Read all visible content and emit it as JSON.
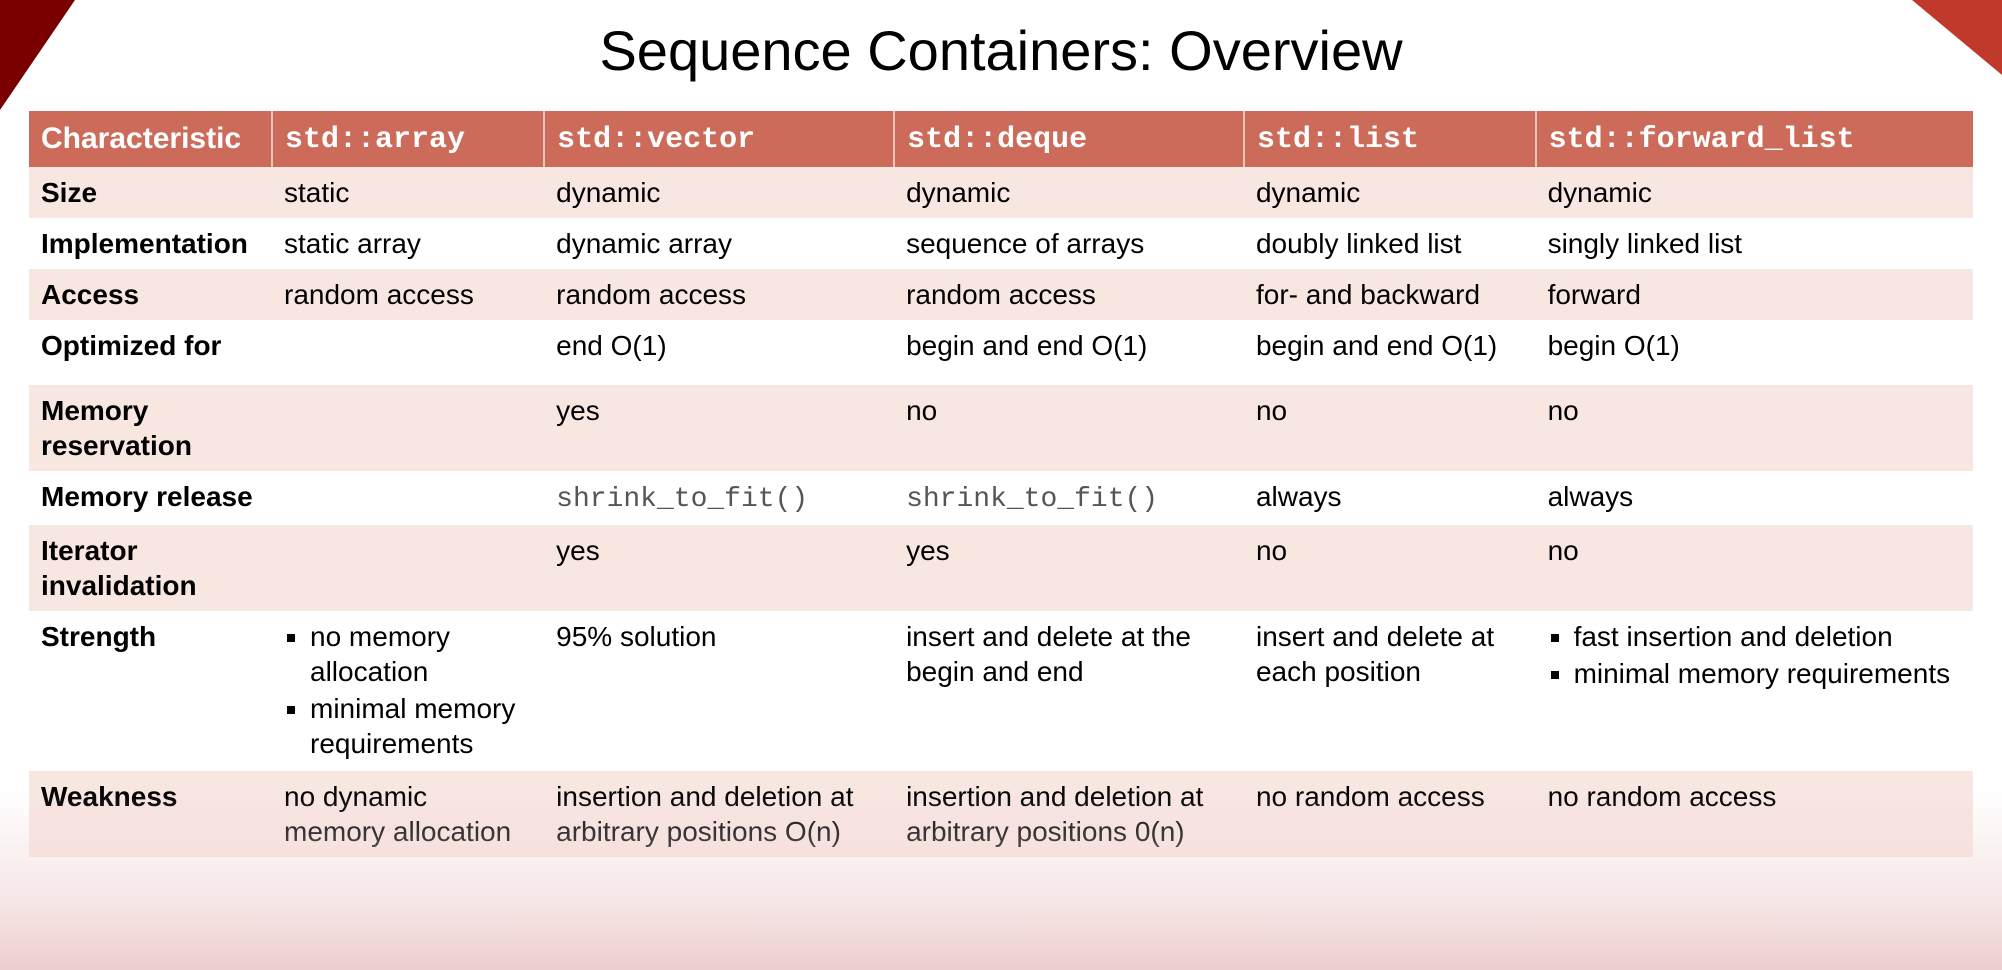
{
  "title": "Sequence Containers: Overview",
  "headers": [
    "Characteristic",
    "std::array",
    "std::vector",
    "std::deque",
    "std::list",
    "std::forward_list"
  ],
  "rows": [
    {
      "label": "Size",
      "alt": true,
      "cells": [
        "static",
        "dynamic",
        "dynamic",
        "dynamic",
        "dynamic"
      ]
    },
    {
      "label": "Implementation",
      "alt": false,
      "cells": [
        "static array",
        "dynamic array",
        "sequence of arrays",
        "doubly linked list",
        "singly linked list"
      ]
    },
    {
      "label": "Access",
      "alt": true,
      "cells": [
        "random access",
        "random access",
        "random access",
        "for- and backward",
        "forward"
      ]
    },
    {
      "label": "Optimized for",
      "alt": false,
      "cells": [
        "",
        "end O(1)",
        "begin and end O(1)",
        "begin and end O(1)",
        "begin O(1)"
      ]
    },
    {
      "label": "Memory reservation",
      "alt": true,
      "cells": [
        "",
        "yes",
        "no",
        "no",
        "no"
      ]
    },
    {
      "label": "Memory release",
      "alt": false,
      "cells": [
        "",
        {
          "text": "shrink_to_fit()",
          "mono": true
        },
        {
          "text": "shrink_to_fit()",
          "mono": true
        },
        "always",
        "always"
      ]
    },
    {
      "label": "Iterator invalidation",
      "alt": true,
      "cells": [
        "",
        "yes",
        "yes",
        "no",
        "no"
      ]
    },
    {
      "label": "Strength",
      "alt": false,
      "cells": [
        {
          "list": [
            "no memory allocation",
            "minimal memory requirements"
          ]
        },
        "95% solution",
        "insert and delete at the begin and end",
        "insert and delete at each position",
        {
          "list": [
            "fast insertion and deletion",
            "minimal memory requirements"
          ]
        }
      ]
    },
    {
      "label": "Weakness",
      "alt": true,
      "cells": [
        "no dynamic memory allocation",
        "insertion and deletion at arbitrary positions O(n)",
        "insertion and deletion at arbitrary positions 0(n)",
        "no random access",
        "no random access"
      ]
    }
  ]
}
